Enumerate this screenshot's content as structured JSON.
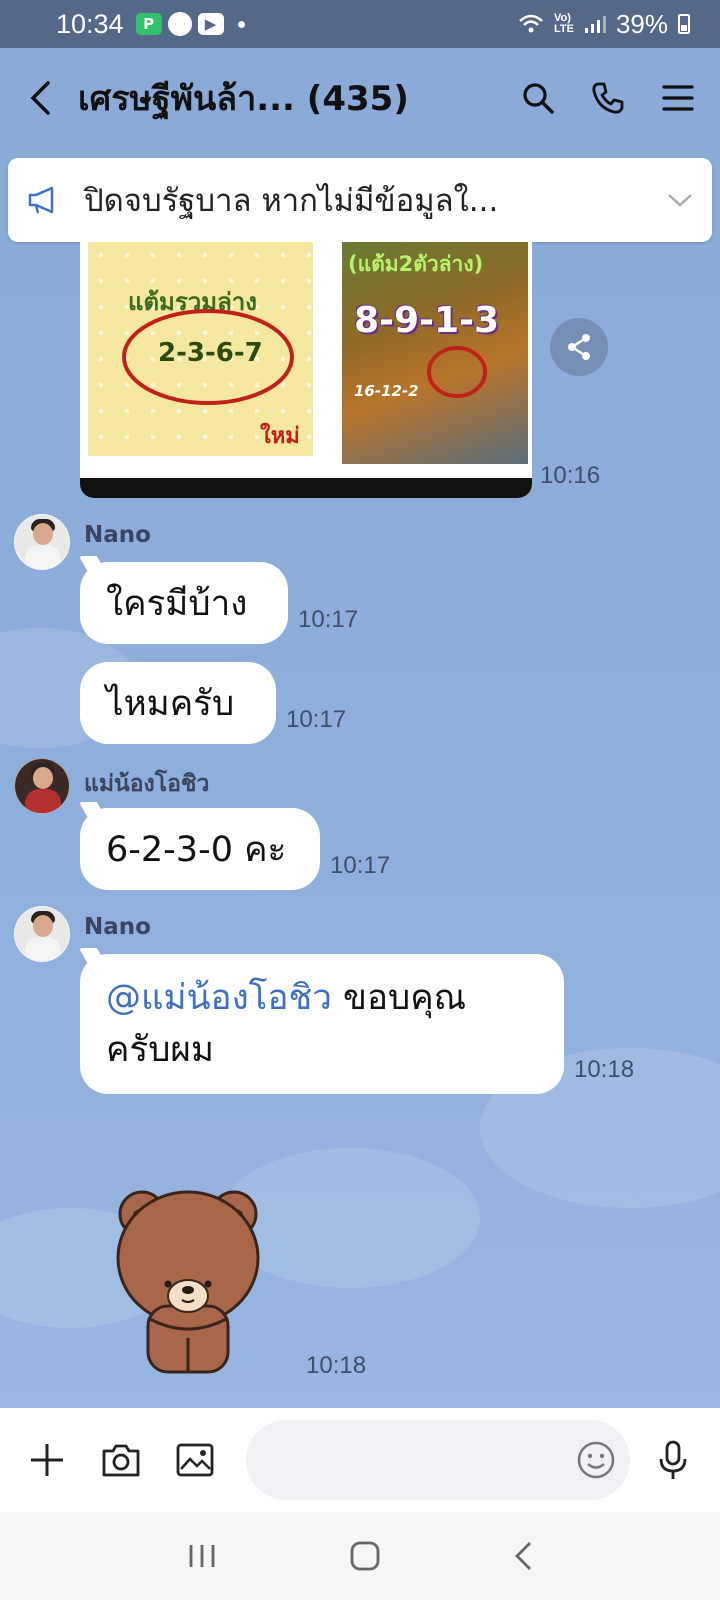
{
  "status_bar": {
    "time": "10:34",
    "battery": "39%",
    "icons": [
      "p-icon",
      "app-icon",
      "youtube-icon",
      "wifi-icon",
      "volte-icon",
      "signal-icon",
      "battery-icon"
    ]
  },
  "header": {
    "title": "เศรษฐีพันล้า... (435)",
    "icons": [
      "back-icon",
      "search-icon",
      "call-icon",
      "menu-icon"
    ]
  },
  "announcement": {
    "text": "ปิดจบรัฐบาล หากไม่มีข้อมูลใ...",
    "icons": [
      "megaphone-icon",
      "chevron-down-icon"
    ]
  },
  "image_message": {
    "left_label": "แต้มรวมล่าง",
    "left_numbers": "2-3-6-7",
    "left_badge": "ใหม่",
    "right_label": "(แต้ม2ตัวล่าง)",
    "right_numbers": "8-9-1-3",
    "right_date": "16-12-2",
    "time": "10:16"
  },
  "messages": [
    {
      "sender": "Nano",
      "text": "ใครมีบ้าง",
      "time": "10:17"
    },
    {
      "text": "ไหมครับ",
      "time": "10:17"
    },
    {
      "sender": "แม่น้องโอชิว",
      "text": "6-2-3-0 คะ",
      "time": "10:17"
    },
    {
      "sender": "Nano",
      "mention": "@แม่น้องโอชิว",
      "text_line1": " ขอบคุณ",
      "text_line2": "ครับผม",
      "time": "10:18"
    }
  ],
  "sticker": {
    "name": "brown-bear-sticker",
    "time": "10:18"
  },
  "input_bar": {
    "icons": [
      "plus-icon",
      "camera-icon",
      "image-icon",
      "emoji-icon",
      "microphone-icon"
    ],
    "placeholder": ""
  },
  "nav_bar": {
    "icons": [
      "recent-apps-icon",
      "home-icon",
      "back-nav-icon"
    ]
  },
  "colors": {
    "chat_bg": "#8badd9",
    "status_bar": "#54688a",
    "bubble": "#ffffff",
    "mention": "#3d6fc4"
  }
}
